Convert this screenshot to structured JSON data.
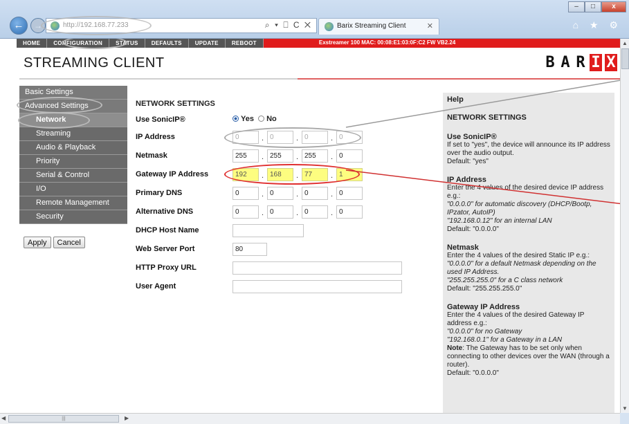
{
  "browser": {
    "url": "http://192.168.77.233",
    "tab_title": "Barix Streaming Client",
    "back_icon": "back-arrow-icon",
    "forward_icon": "forward-arrow-icon",
    "address_tools": "⌕ ▾ ⎕ C ✕",
    "tab_close": "✕",
    "chrome_icons": "⌂ ★ ⚙",
    "window_min": "–",
    "window_max": "□",
    "window_close": "x"
  },
  "topnav": {
    "items": [
      "HOME",
      "CONFIGURATION",
      "STATUS",
      "DEFAULTS",
      "UPDATE",
      "REBOOT"
    ],
    "device_info": "Exstreamer 100   MAC: 00:08:E1:03:0F:C2  FW VB2.24"
  },
  "header": {
    "title": "STREAMING CLIENT",
    "logo": [
      "B",
      "A",
      "R",
      "I",
      "X"
    ],
    "accent_color": "#e01c1c"
  },
  "sidebar": {
    "items": [
      {
        "label": "Basic Settings"
      },
      {
        "label": "Advanced Settings"
      },
      {
        "label": "Network"
      },
      {
        "label": "Streaming"
      },
      {
        "label": "Audio & Playback"
      },
      {
        "label": "Priority"
      },
      {
        "label": "Serial & Control"
      },
      {
        "label": "I/O"
      },
      {
        "label": "Remote Management"
      },
      {
        "label": "Security"
      }
    ],
    "apply": "Apply",
    "cancel": "Cancel"
  },
  "form": {
    "title": "NETWORK SETTINGS",
    "sonicip": {
      "label": "Use SonicIP®",
      "yes": "Yes",
      "no": "No",
      "selected": "Yes"
    },
    "ip_address": {
      "label": "IP Address",
      "values": [
        "0",
        "0",
        "0",
        "0"
      ]
    },
    "netmask": {
      "label": "Netmask",
      "values": [
        "255",
        "255",
        "255",
        "0"
      ]
    },
    "gateway": {
      "label": "Gateway IP Address",
      "values": [
        "192",
        "168",
        "77",
        "1"
      ]
    },
    "primary_dns": {
      "label": "Primary DNS",
      "values": [
        "0",
        "0",
        "0",
        "0"
      ]
    },
    "alt_dns": {
      "label": "Alternative DNS",
      "values": [
        "0",
        "0",
        "0",
        "0"
      ]
    },
    "dhcp_host": {
      "label": "DHCP Host Name",
      "value": ""
    },
    "web_port": {
      "label": "Web Server Port",
      "value": "80"
    },
    "proxy": {
      "label": "HTTP Proxy URL",
      "value": ""
    },
    "agent": {
      "label": "User Agent",
      "value": ""
    }
  },
  "help": {
    "title": "Help",
    "heading": "NETWORK SETTINGS",
    "sonicip_title": "Use SonicIP®",
    "sonicip_text": "If set to \"yes\", the device will announce its IP address over the audio output.",
    "sonicip_default": "Default: \"yes\"",
    "ip_title": "IP Address",
    "ip_text": "Enter the 4 values of the desired device IP address e.g.:",
    "ip_ex1": "\"0.0.0.0\" for automatic discovery (DHCP/Bootp, IPzator, AutoIP)",
    "ip_ex2": "\"192.168.0.12\" for an internal LAN",
    "ip_default": "Default: \"0.0.0.0\"",
    "nm_title": "Netmask",
    "nm_text": "Enter the 4 values of the desired Static IP e.g.:",
    "nm_ex1": "\"0.0.0.0\" for a default Netmask depending on the used IP Address.",
    "nm_ex2": "\"255.255.255.0\" for a C class network",
    "nm_default": "Default: \"255.255.255.0\"",
    "gw_title": "Gateway IP Address",
    "gw_text": "Enter the 4 values of the desired Gateway IP address e.g.:",
    "gw_ex1": "\"0.0.0.0\" for no Gateway",
    "gw_ex2": "\"192.168.0.1\" for a Gateway in a LAN",
    "gw_note_label": "Note",
    "gw_note": ": The Gateway has to be set only when connecting to other devices over the WAN (through a router).",
    "gw_default": "Default: \"0.0.0.0\""
  }
}
